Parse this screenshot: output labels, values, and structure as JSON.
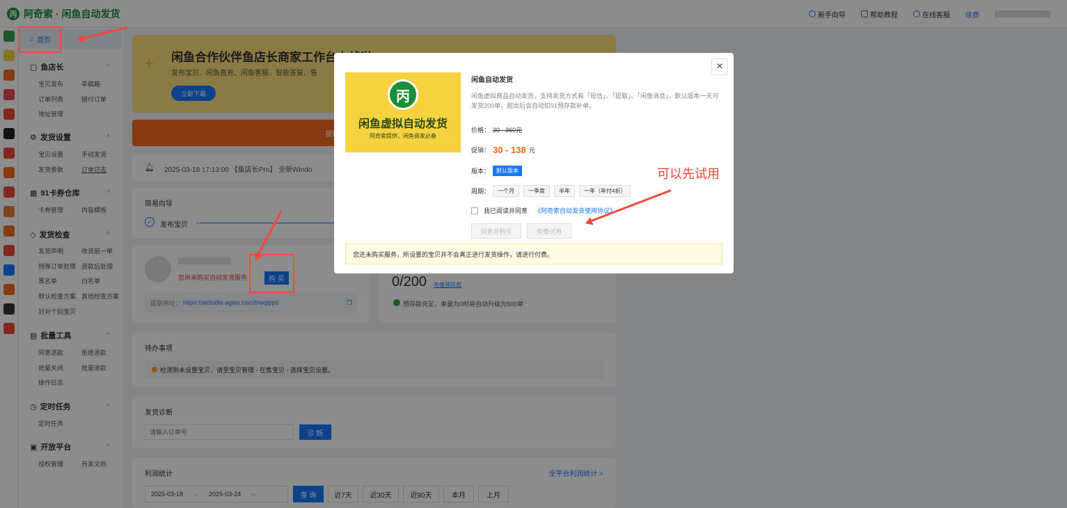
{
  "app": {
    "logo_char": "丙",
    "title": "阿奇索 · 闲鱼自动发货"
  },
  "topnav": {
    "guide": "新手向导",
    "help": "帮助教程",
    "service": "在线客服",
    "renew": "续费"
  },
  "sidebar": {
    "home": "首页",
    "groups": [
      {
        "title": "鱼店长",
        "items": [
          "宝贝发布",
          "草稿箱",
          "订单列表",
          "赔付订单",
          "地址管理"
        ]
      },
      {
        "title": "发货设置",
        "items": [
          "宝贝设置",
          "手动发货",
          "发货参数",
          "订单日志"
        ]
      },
      {
        "title": "91卡券仓库",
        "items": [
          "卡券管理",
          "内容模板"
        ]
      },
      {
        "title": "发货检查",
        "items": [
          "发货声明",
          "收货前一单",
          "特殊订单处理",
          "退款后处理",
          "黑名单",
          "白名单",
          "默认检查方案",
          "其他检查方案",
          "针对个别宝贝"
        ]
      },
      {
        "title": "批量工具",
        "items": [
          "同意退款",
          "拒绝退款",
          "批量关闭",
          "批量退款",
          "操作日志"
        ]
      },
      {
        "title": "定时任务",
        "items": [
          "定时任务"
        ]
      },
      {
        "title": "开放平台",
        "items": [
          "授权管理",
          "开发文档"
        ]
      }
    ]
  },
  "banner": {
    "title": "闲鱼合作伙伴鱼店长商家工作台上线啦",
    "desc": "发布宝贝、闲鱼直充、闲鱼客服、智能答复、售",
    "btn": "立即下载"
  },
  "notice": {
    "text": "提醒：因闲鱼平台限制，自动发"
  },
  "announce": {
    "text": "2025-03-18 17:13:00 【鱼店长Pro】 全新Windo"
  },
  "guide": {
    "title": "简易向导",
    "step1": "发布宝贝"
  },
  "account": {
    "unpaid": "您尚未购买自动发货服务",
    "buy": "购 买",
    "url_label": "提取网址：",
    "url": "https://aldsidle.agiso.com/t/wqtpps"
  },
  "stock": {
    "value": "0/200",
    "link": "充值预存款",
    "note": "预存款充足，单量为0时将自动升级为500单"
  },
  "todo": {
    "title": "待办事项",
    "item": "检测到未设置宝贝，请至宝贝管理 - 在售宝贝 - 选择宝贝设置。"
  },
  "diagnose": {
    "title": "发货诊断",
    "placeholder": "请输入订单号",
    "btn": "诊 断"
  },
  "profit": {
    "title": "利润统计",
    "link": "全平台利润统计 >",
    "start": "2025-03-18",
    "end": "2025-03-24",
    "query": "查 询",
    "ranges": [
      "近7天",
      "近30天",
      "近90天",
      "本月",
      "上月"
    ]
  },
  "modal": {
    "img_big": "闲鱼虚拟自动发货",
    "img_small": "阿奇索提供，闲鱼商家必备",
    "title": "闲鱼自动发货",
    "desc": "闲鱼虚拟商品自动发货，支持发货方式有「短信」、「提取」、「闲鱼消息」。默认版本一天可发货200单，超出后会自动扣91预存款补单。",
    "price_label": "价格：",
    "price": "30 - 360元",
    "promo_label": "促销：",
    "promo": "30 - 138",
    "promo_unit": "元",
    "version_label": "版本：",
    "version": "默认版本",
    "cycle_label": "周期：",
    "cycles": [
      "一个月",
      "一季度",
      "半年",
      "一年（年付4折）"
    ],
    "agree": "我已阅读并同意",
    "agree_link": "《阿奇索自动发货使用协议》",
    "btn_buy": "同意并购买",
    "btn_trial": "免费试用",
    "warn": "您还未购买服务，所设置的宝贝并不会真正进行发货操作，请进行付费。"
  },
  "annotation": "可以先试用",
  "colors": {
    "brand": "#1b8f3a",
    "accent": "#1677ff",
    "warning": "#f26b1d",
    "annotation": "#e94a3a"
  }
}
